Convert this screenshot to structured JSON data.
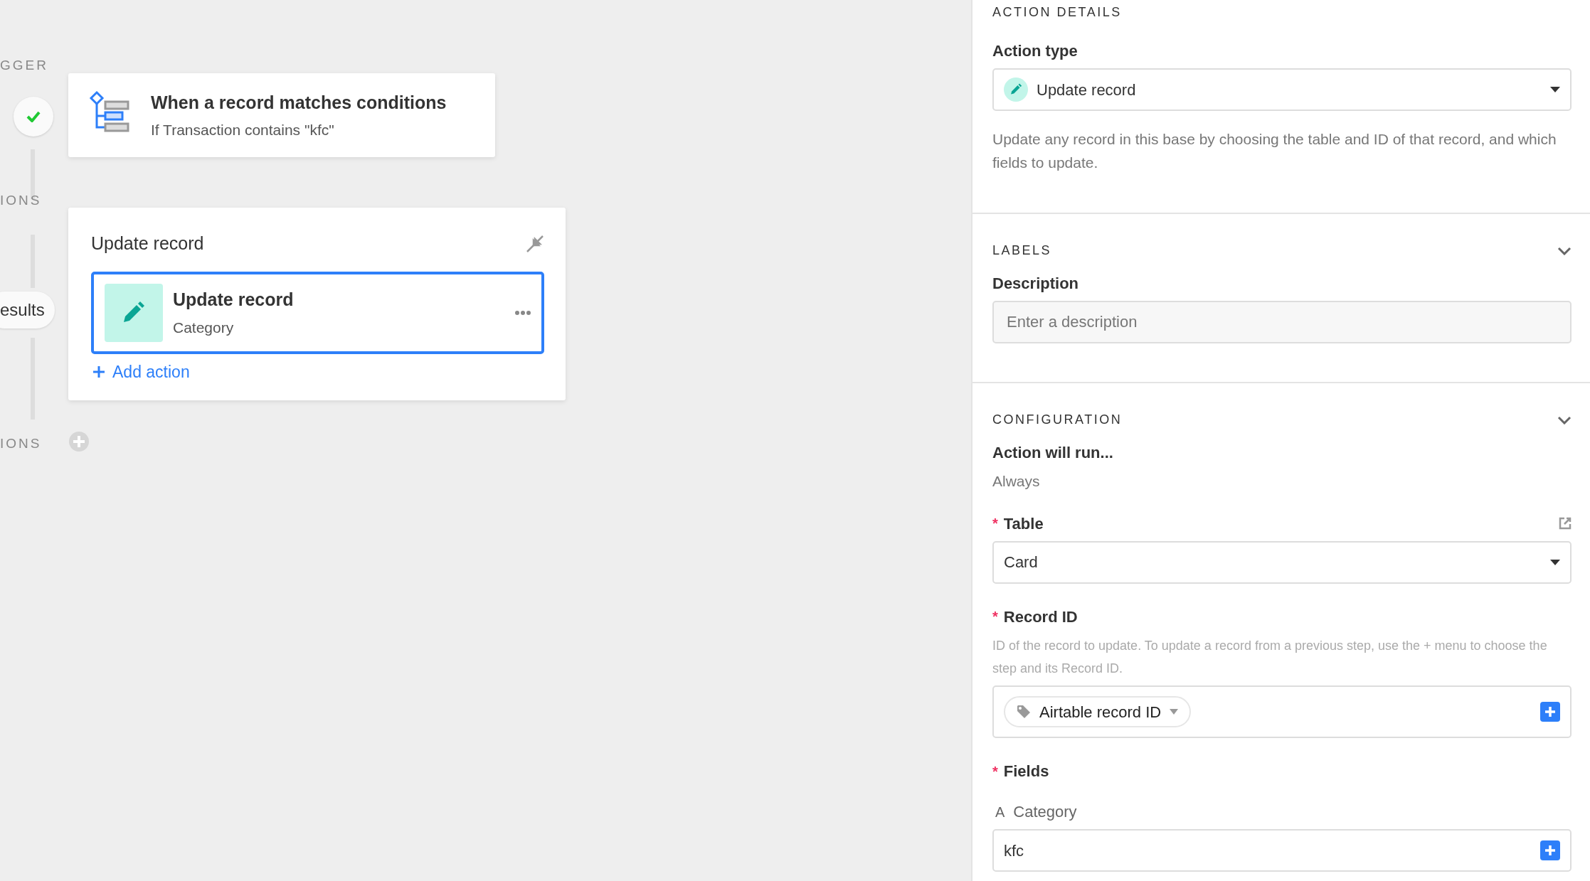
{
  "rail": {
    "labels": [
      "GGER",
      "IONS",
      "IONS"
    ],
    "pill": "esults"
  },
  "trigger": {
    "title": "When a record matches conditions",
    "subtitle": "If Transaction contains \"kfc\""
  },
  "action_group": {
    "title": "Update record",
    "actions": [
      {
        "title": "Update record",
        "subtitle": "Category",
        "selected": true
      }
    ],
    "add_label": "Add action"
  },
  "panel": {
    "heading": "ACTION DETAILS",
    "action_type": {
      "label": "Action type",
      "value": "Update record",
      "description": "Update any record in this base by choosing the table and ID of that record, and which fields to update."
    },
    "labels_section": {
      "title": "LABELS",
      "expanded": true,
      "field_label": "Description",
      "placeholder": "Enter a description"
    },
    "config_section": {
      "title": "CONFIGURATION",
      "expanded": true,
      "run_label": "Action will run...",
      "run_value": "Always",
      "table": {
        "label": "Table",
        "required_mark": "*",
        "value": "Card"
      },
      "record_id": {
        "label": "Record ID",
        "required_mark": "*",
        "help": "ID of the record to update. To update a record from a previous step, use the + menu to choose the step and its Record ID.",
        "chip": "Airtable record ID"
      },
      "fields": {
        "label": "Fields",
        "required_mark": "*",
        "items": [
          {
            "type_glyph": "A",
            "name": "Category",
            "value": "kfc"
          }
        ]
      }
    }
  }
}
